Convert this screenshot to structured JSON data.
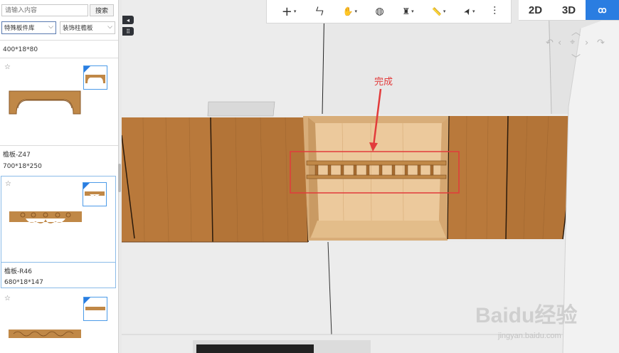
{
  "sidebar": {
    "search": {
      "placeholder": "请输入内容",
      "button": "搜索"
    },
    "filters": [
      {
        "label": "特殊板件库",
        "icon": "chevron-down-icon"
      },
      {
        "label": "装饰柱檐板",
        "icon": "chevron-down-icon"
      }
    ],
    "top_item_size": "400*18*80",
    "items": [
      {
        "name": "檐板-Z47",
        "size": "700*18*250",
        "selected": false
      },
      {
        "name": "檐板-R46",
        "size": "680*18*147",
        "selected": true
      },
      {
        "name": "",
        "size": "",
        "selected": false
      }
    ]
  },
  "toolbar": {
    "tools": [
      {
        "icon": "plus-icon",
        "glyph": "+",
        "has_menu": true
      },
      {
        "icon": "chair-icon",
        "glyph": "ㄣ",
        "has_menu": false
      },
      {
        "icon": "hand-icon",
        "glyph": "✋",
        "has_menu": true
      },
      {
        "icon": "palette-icon",
        "glyph": "◍",
        "has_menu": false
      },
      {
        "icon": "paint-roller-icon",
        "glyph": "♜",
        "has_menu": true
      },
      {
        "icon": "ruler-icon",
        "glyph": "📏",
        "has_menu": true
      },
      {
        "icon": "cursor-icon",
        "glyph": "➤",
        "has_menu": true
      },
      {
        "icon": "sliders-icon",
        "glyph": "⫶",
        "has_menu": false
      }
    ]
  },
  "view_toggle": {
    "2d": "2D",
    "3d": "3D",
    "walk": "ꝏ"
  },
  "annotation": {
    "label": "完成",
    "color": "#e23b3b"
  },
  "watermark": {
    "brand": "Baidu经验",
    "url": "jingyan.baidu.com"
  },
  "colors": {
    "accent": "#2a7de1",
    "wood": "#b57a3e",
    "highlight": "#e23b3b"
  }
}
